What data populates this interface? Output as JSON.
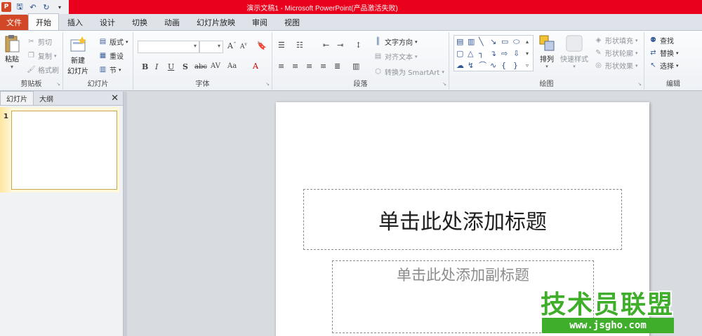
{
  "window": {
    "title": "演示文稿1 - Microsoft PowerPoint(产品激活失败)",
    "app_icon": "P"
  },
  "ribbon_tabs": [
    "文件",
    "开始",
    "插入",
    "设计",
    "切换",
    "动画",
    "幻灯片放映",
    "审阅",
    "视图"
  ],
  "clipboard": {
    "paste": "粘贴",
    "cut": "剪切",
    "copy": "复制",
    "format_painter": "格式刷",
    "group": "剪贴板"
  },
  "slides_group": {
    "new_slide_line1": "新建",
    "new_slide_line2": "幻灯片",
    "layout": "版式",
    "reset": "重设",
    "section": "节",
    "group": "幻灯片"
  },
  "font_group": {
    "group": "字体"
  },
  "paragraph_group": {
    "text_direction": "文字方向",
    "align_text": "对齐文本",
    "convert_smartart": "转换为 SmartArt",
    "group": "段落"
  },
  "drawing_group": {
    "arrange": "排列",
    "quick_styles": "快速样式",
    "shape_fill": "形状填充",
    "shape_outline": "形状轮廓",
    "shape_effects": "形状效果",
    "group": "绘图"
  },
  "editing_group": {
    "find": "查找",
    "replace": "替换",
    "select": "选择",
    "group": "编辑"
  },
  "left_panel": {
    "tab_slides": "幻灯片",
    "tab_outline": "大纲",
    "slide_number": "1"
  },
  "slide": {
    "title_placeholder": "单击此处添加标题",
    "subtitle_placeholder": "单击此处添加副标题"
  },
  "watermark": {
    "title": "技术员联盟",
    "url": "www.jsgho.com"
  },
  "colors": {
    "title_bar": "#e8001c",
    "file_tab": "#d24726",
    "watermark": "#3fae2a"
  }
}
